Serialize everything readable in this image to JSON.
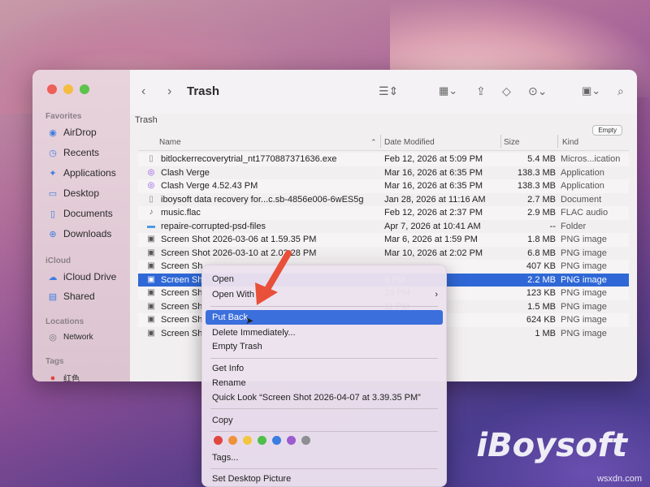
{
  "window": {
    "title": "Trash",
    "path": "Trash",
    "empty_label": "Empty"
  },
  "sidebar": {
    "sections": {
      "favorites": "Favorites",
      "icloud": "iCloud",
      "locations": "Locations",
      "tags": "Tags"
    },
    "items": [
      {
        "label": "AirDrop",
        "icon": "airdrop-icon"
      },
      {
        "label": "Recents",
        "icon": "clock-icon"
      },
      {
        "label": "Applications",
        "icon": "applications-icon"
      },
      {
        "label": "Desktop",
        "icon": "desktop-icon"
      },
      {
        "label": "Documents",
        "icon": "document-icon"
      },
      {
        "label": "Downloads",
        "icon": "download-icon"
      },
      {
        "label": "iCloud Drive",
        "icon": "cloud-icon"
      },
      {
        "label": "Shared",
        "icon": "shared-folder-icon"
      },
      {
        "label": "Network",
        "icon": "globe-icon"
      },
      {
        "label": "红色",
        "icon": "red-tag-icon"
      }
    ]
  },
  "columns": {
    "name": "Name",
    "date": "Date Modified",
    "size": "Size",
    "kind": "Kind"
  },
  "files": [
    {
      "name": "bitlockerrecoverytrial_nt1770887371636.exe",
      "date": "Feb 12, 2026 at 5:09 PM",
      "size": "5.4 MB",
      "kind": "Micros...ication",
      "icon": "file-icon"
    },
    {
      "name": "Clash Verge",
      "date": "Mar 16, 2026 at 6:35 PM",
      "size": "138.3 MB",
      "kind": "Application",
      "icon": "app-icon"
    },
    {
      "name": "Clash Verge 4.52.43 PM",
      "date": "Mar 16, 2026 at 6:35 PM",
      "size": "138.3 MB",
      "kind": "Application",
      "icon": "app-icon"
    },
    {
      "name": "iboysoft data recovery for...c.sb-4856e006-6wES5g",
      "date": "Jan 28, 2026 at 11:16 AM",
      "size": "2.7 MB",
      "kind": "Document",
      "icon": "file-icon"
    },
    {
      "name": "music.flac",
      "date": "Feb 12, 2026 at 2:37 PM",
      "size": "2.9 MB",
      "kind": "FLAC audio",
      "icon": "audio-file-icon"
    },
    {
      "name": "repaire-corrupted-psd-files",
      "date": "Apr 7, 2026 at 10:41 AM",
      "size": "--",
      "kind": "Folder",
      "icon": "folder-icon"
    },
    {
      "name": "Screen Shot 2026-03-06 at 1.59.35 PM",
      "date": "Mar 6, 2026 at 1:59 PM",
      "size": "1.8 MB",
      "kind": "PNG image",
      "icon": "image-icon"
    },
    {
      "name": "Screen Shot 2026-03-10 at 2.02.28 PM",
      "date": "Mar 10, 2026 at 2:02 PM",
      "size": "6.8 MB",
      "kind": "PNG image",
      "icon": "image-icon"
    },
    {
      "name": "Screen Sh",
      "date": "",
      "size": "407 KB",
      "kind": "PNG image",
      "icon": "image-icon"
    },
    {
      "name": "Screen Sh",
      "date": "9 PM",
      "size": "2.2 MB",
      "kind": "PNG image",
      "icon": "image-icon",
      "selected": true
    },
    {
      "name": "Screen Sh",
      "date": "20 PM",
      "size": "123 KB",
      "kind": "PNG image",
      "icon": "image-icon"
    },
    {
      "name": "Screen Sh",
      "date": "11 PM",
      "size": "1.5 MB",
      "kind": "PNG image",
      "icon": "image-icon"
    },
    {
      "name": "Screen Sh",
      "date": "11 AM",
      "size": "624 KB",
      "kind": "PNG image",
      "icon": "image-icon"
    },
    {
      "name": "Screen Sh",
      "date": "",
      "size": "1 MB",
      "kind": "PNG image",
      "icon": "image-icon"
    }
  ],
  "context_menu": {
    "open": "Open",
    "open_with": "Open With",
    "put_back": "Put Back",
    "delete_immediately": "Delete Immediately...",
    "empty_trash": "Empty Trash",
    "get_info": "Get Info",
    "rename": "Rename",
    "quick_look": "Quick Look “Screen Shot 2026-04-07 at 3.39.35 PM”",
    "copy": "Copy",
    "tags": "Tags...",
    "set_desktop_picture": "Set Desktop Picture",
    "tag_colors": [
      "#e0463f",
      "#f0923a",
      "#f3c640",
      "#4fbf4a",
      "#3b7de0",
      "#9c5bd1",
      "#8e8e93"
    ]
  },
  "watermark": {
    "brand": "iBoysoft",
    "site": "wsxdn.com"
  },
  "colors": {
    "accent": "#3b6fdc",
    "selection": "#2f68d6",
    "arrow": "#e8503a"
  }
}
